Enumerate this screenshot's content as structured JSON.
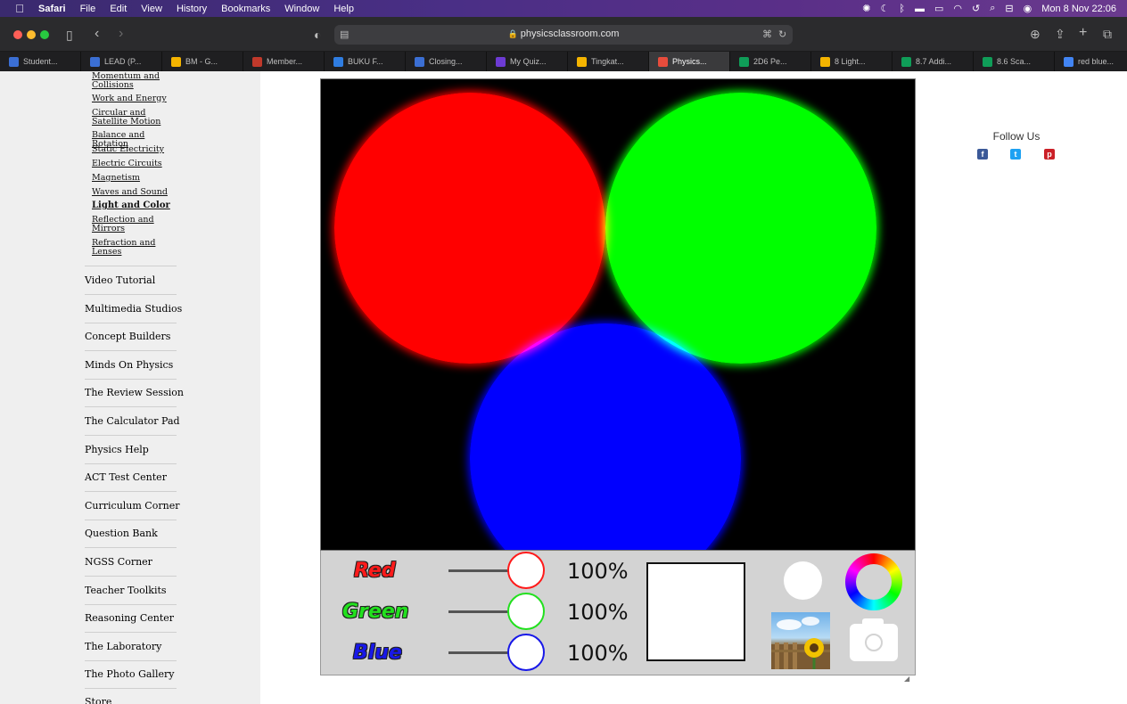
{
  "menubar": {
    "apple_icon": "apple-icon",
    "app_name": "Safari",
    "items": [
      "File",
      "Edit",
      "View",
      "History",
      "Bookmarks",
      "Window",
      "Help"
    ],
    "clock": "Mon 8 Nov  22:06",
    "status_icons": [
      "gear-icon",
      "moon-icon",
      "bluetooth-icon",
      "flag-icon",
      "battery-icon",
      "wifi-icon",
      "time-machine-icon",
      "search-icon",
      "control-center-icon",
      "siri-icon"
    ]
  },
  "toolbar": {
    "url": "physicsclassroom.com"
  },
  "tabs": [
    {
      "label": "Student...",
      "color": "#3b6fd4"
    },
    {
      "label": "LEAD (P...",
      "color": "#3b6fd4"
    },
    {
      "label": "BM - G...",
      "color": "#f4b400"
    },
    {
      "label": "Member...",
      "color": "#c0392b"
    },
    {
      "label": "BUKU F...",
      "color": "#2f7de1"
    },
    {
      "label": "Closing...",
      "color": "#3b6fd4"
    },
    {
      "label": "My Quiz...",
      "color": "#6d3bd4"
    },
    {
      "label": "Tingkat...",
      "color": "#f4b400"
    },
    {
      "label": "Physics...",
      "color": "#e74c3c"
    },
    {
      "label": "2D6 Pe...",
      "color": "#0f9d58"
    },
    {
      "label": "8 Light...",
      "color": "#f4b400"
    },
    {
      "label": "8.7 Addi...",
      "color": "#0f9d58"
    },
    {
      "label": "8.6 Sca...",
      "color": "#0f9d58"
    },
    {
      "label": "red blue...",
      "color": "#4285f4"
    }
  ],
  "sidebar": {
    "sublinks": [
      {
        "label": "Momentum and Collisions"
      },
      {
        "label": "Work and Energy"
      },
      {
        "label": "Circular and Satellite Motion"
      },
      {
        "label": "Balance and Rotation"
      },
      {
        "label": "Static Electricity"
      },
      {
        "label": "Electric Circuits"
      },
      {
        "label": "Magnetism"
      },
      {
        "label": "Waves and Sound"
      },
      {
        "label": "Light and Color"
      },
      {
        "label": "Reflection and Mirrors"
      },
      {
        "label": "Refraction and Lenses"
      }
    ],
    "nav": [
      {
        "label": "Video Tutorial",
        "color": "#e8382d"
      },
      {
        "label": "Multimedia Studios",
        "color": "#e8382d"
      },
      {
        "label": "Concept Builders",
        "color": "#2b8f9c"
      },
      {
        "label": "Minds On Physics",
        "color": "#2b8f9c"
      },
      {
        "label": "The Review Session",
        "color": "#2b8f9c"
      },
      {
        "label": "The Calculator Pad",
        "color": "#2b8f9c"
      },
      {
        "label": "Physics Help",
        "color": "#2b8f9c"
      },
      {
        "label": "ACT Test Center",
        "color": "#2b8f9c"
      },
      {
        "label": "Curriculum Corner",
        "color": "#c48a1c"
      },
      {
        "label": "Question Bank",
        "color": "#c48a1c"
      },
      {
        "label": "NGSS Corner",
        "color": "#c48a1c"
      },
      {
        "label": "Teacher Toolkits",
        "color": "#c48a1c"
      },
      {
        "label": "Reasoning Center",
        "color": "#c48a1c"
      },
      {
        "label": "The Laboratory",
        "color": "#c48a1c"
      },
      {
        "label": "The Photo Gallery",
        "color": "#c48a1c"
      },
      {
        "label": "Store",
        "color": "#2b5aa8"
      }
    ]
  },
  "simulator": {
    "colors": {
      "red": "#ff0000",
      "green": "#00ff00",
      "blue": "#0000ff"
    },
    "controls": [
      {
        "label": "Red",
        "value": "100%",
        "color": "#ff1a1a",
        "level": 1.0
      },
      {
        "label": "Green",
        "value": "100%",
        "color": "#22e01e",
        "level": 1.0
      },
      {
        "label": "Blue",
        "value": "100%",
        "color": "#1818e8",
        "level": 1.0
      }
    ],
    "mixed_color": "#ffffff",
    "tool_icons": [
      "white-light-icon",
      "color-wheel-icon",
      "photo-icon",
      "camera-icon"
    ]
  },
  "follow": {
    "title": "Follow Us",
    "networks": [
      {
        "name": "facebook-icon",
        "glyph": "f",
        "color": "#3b5998"
      },
      {
        "name": "twitter-icon",
        "glyph": "t",
        "color": "#1da1f2"
      },
      {
        "name": "pinterest-icon",
        "glyph": "p",
        "color": "#cb2027"
      }
    ]
  }
}
